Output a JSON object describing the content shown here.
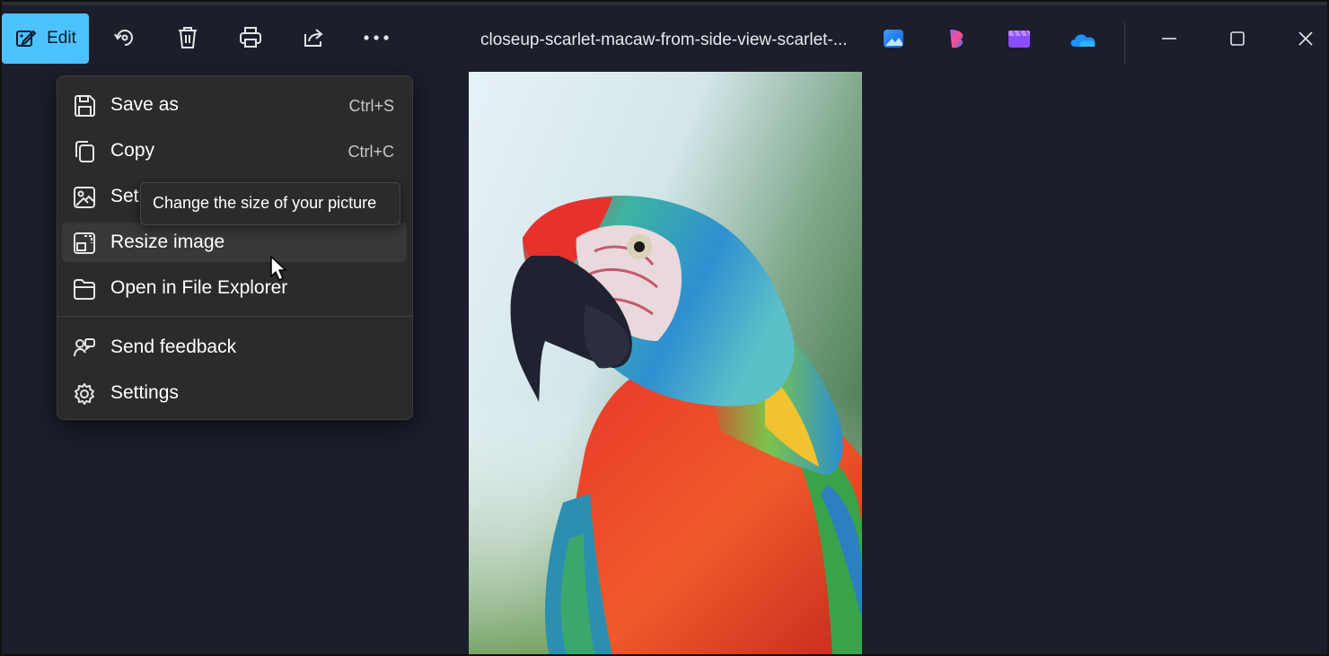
{
  "toolbar": {
    "edit_label": "Edit",
    "filename": "closeup-scarlet-macaw-from-side-view-scarlet-...",
    "icons": [
      "edit-pencil-icon",
      "rotate-icon",
      "delete-icon",
      "print-icon",
      "share-icon",
      "more-icon"
    ],
    "apps": [
      "photos-app-icon",
      "clipchamp-icon",
      "video-editor-icon",
      "onedrive-icon"
    ],
    "window": [
      "minimize-icon",
      "maximize-icon",
      "close-icon"
    ]
  },
  "menu": {
    "items": [
      {
        "label": "Save as",
        "shortcut": "Ctrl+S",
        "icon": "save-icon"
      },
      {
        "label": "Copy",
        "shortcut": "Ctrl+C",
        "icon": "copy-icon"
      },
      {
        "label": "Set",
        "shortcut": "",
        "icon": "set-as-icon"
      },
      {
        "label": "Resize image",
        "shortcut": "",
        "icon": "resize-icon"
      },
      {
        "label": "Open in File Explorer",
        "shortcut": "",
        "icon": "folder-icon"
      },
      {
        "label": "Send feedback",
        "shortcut": "",
        "icon": "feedback-icon"
      },
      {
        "label": "Settings",
        "shortcut": "",
        "icon": "settings-icon"
      }
    ]
  },
  "tooltip": {
    "text": "Change the size of your picture"
  },
  "colors": {
    "accent": "#4cc2ff",
    "background": "#1b1e2b",
    "menu": "#2b2b2b"
  }
}
